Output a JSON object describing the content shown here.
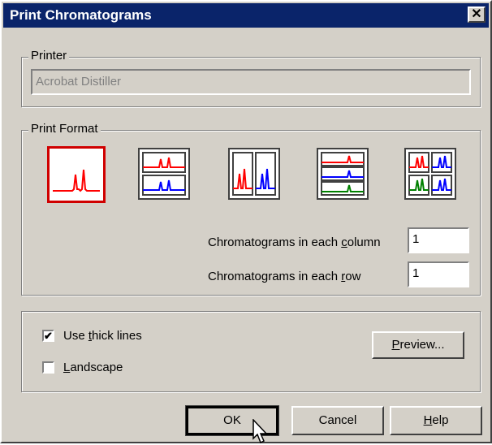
{
  "window": {
    "title": "Print Chromatograms",
    "close_label": "✕"
  },
  "printer": {
    "group_label": "Printer",
    "name": "Acrobat Distiller"
  },
  "print_format": {
    "group_label": "Print Format",
    "layouts": [
      "single",
      "2 rows",
      "2 columns",
      "3 rows",
      "2x2 grid"
    ],
    "selected_index": 0,
    "column_label": {
      "pre": "Chromatograms in each ",
      "accel": "c",
      "post": "olumn"
    },
    "column_value": "1",
    "row_label": {
      "pre": "Chromatograms in each ",
      "accel": "r",
      "post": "ow"
    },
    "row_value": "1"
  },
  "options": {
    "thick_lines": {
      "pre": "Use ",
      "accel": "t",
      "post": "hick lines",
      "checked": true,
      "mark": "✔"
    },
    "landscape": {
      "pre": "",
      "accel": "L",
      "post": "andscape",
      "checked": false,
      "mark": ""
    }
  },
  "buttons": {
    "preview": {
      "accel": "P",
      "post": "review..."
    },
    "ok": "OK",
    "cancel": "Cancel",
    "help": {
      "accel": "H",
      "post": "elp"
    }
  },
  "colors": {
    "red": "#ff0000",
    "blue": "#0000ff",
    "green": "#008000",
    "title_bg": "#0a246a"
  }
}
